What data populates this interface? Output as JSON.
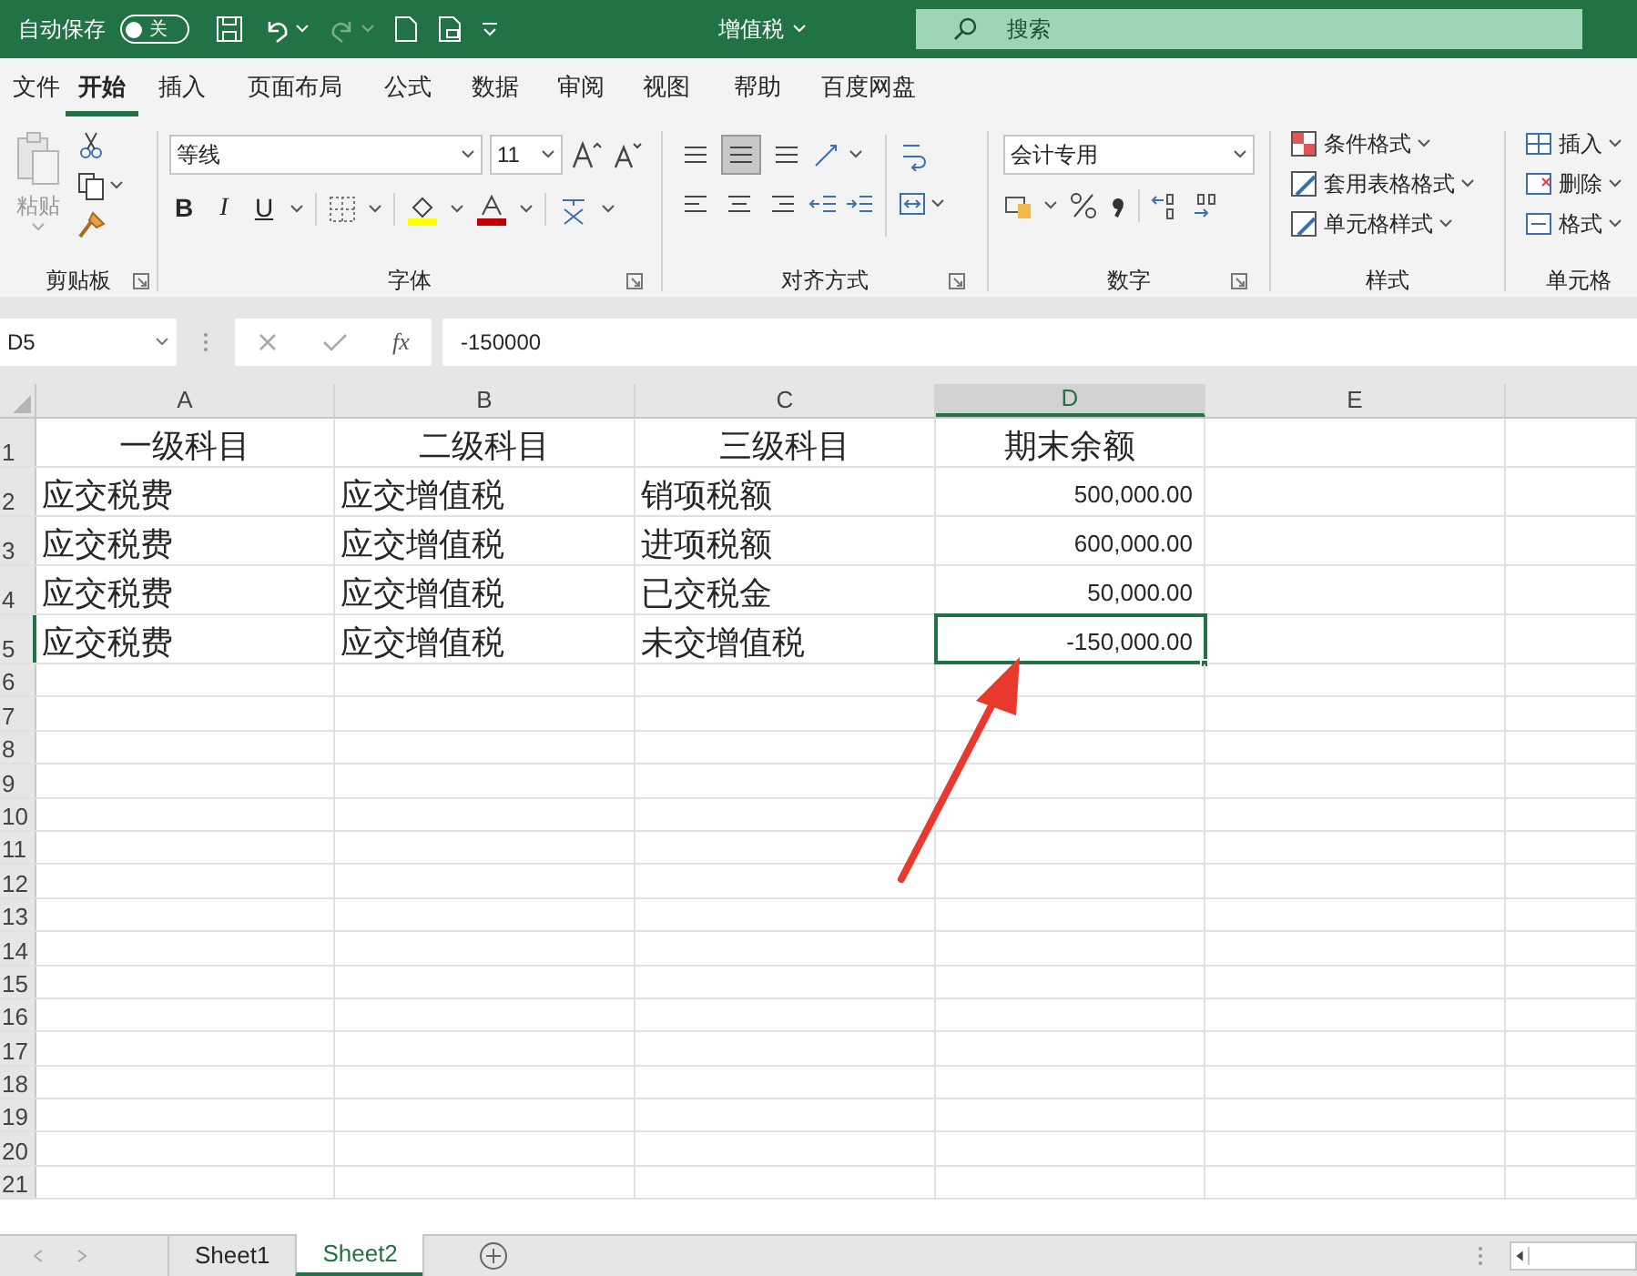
{
  "title_bar": {
    "autosave_label": "自动保存",
    "autosave_toggle": {
      "label": "关",
      "on": false
    },
    "document_title": "增值税",
    "search": {
      "placeholder": "搜索"
    }
  },
  "menu_tabs": [
    {
      "label": "文件",
      "selected": false
    },
    {
      "label": "开始",
      "selected": true
    },
    {
      "label": "插入",
      "selected": false
    },
    {
      "label": "页面布局",
      "selected": false
    },
    {
      "label": "公式",
      "selected": false
    },
    {
      "label": "数据",
      "selected": false
    },
    {
      "label": "审阅",
      "selected": false
    },
    {
      "label": "视图",
      "selected": false
    },
    {
      "label": "帮助",
      "selected": false
    },
    {
      "label": "百度网盘",
      "selected": false
    }
  ],
  "ribbon": {
    "clipboard": {
      "paste_label": "粘贴",
      "group_label": "剪贴板"
    },
    "font": {
      "font_name": "等线",
      "font_size": "11",
      "bold": "B",
      "italic": "I",
      "underline": "U",
      "group_label": "字体"
    },
    "alignment": {
      "group_label": "对齐方式"
    },
    "number": {
      "format": "会计专用",
      "group_label": "数字"
    },
    "styles": {
      "items": [
        "条件格式",
        "套用表格格式",
        "单元格样式"
      ],
      "group_label": "样式"
    },
    "cells": {
      "items": [
        "插入",
        "删除",
        "格式"
      ],
      "group_label": "单元格"
    }
  },
  "formula_bar": {
    "name_box": "D5",
    "function_symbol": "fx",
    "value": "-150000"
  },
  "sheet": {
    "columns": [
      {
        "label": "A",
        "selected": false
      },
      {
        "label": "B",
        "selected": false
      },
      {
        "label": "C",
        "selected": false
      },
      {
        "label": "D",
        "selected": true
      },
      {
        "label": "E",
        "selected": false
      }
    ],
    "rows": [
      {
        "number": "1",
        "selected": false,
        "cells": [
          "一级科目",
          "二级科目",
          "三级科目",
          "期末余额",
          ""
        ]
      },
      {
        "number": "2",
        "selected": false,
        "cells": [
          "应交税费",
          "应交增值税",
          "销项税额",
          "500,000.00",
          ""
        ]
      },
      {
        "number": "3",
        "selected": false,
        "cells": [
          "应交税费",
          "应交增值税",
          "进项税额",
          "600,000.00",
          ""
        ]
      },
      {
        "number": "4",
        "selected": false,
        "cells": [
          "应交税费",
          "应交增值税",
          "已交税金",
          "50,000.00",
          ""
        ]
      },
      {
        "number": "5",
        "selected": true,
        "cells": [
          "应交税费",
          "应交增值税",
          "未交增值税",
          "-150,000.00",
          ""
        ]
      },
      {
        "number": "6",
        "selected": false
      },
      {
        "number": "7",
        "selected": false
      },
      {
        "number": "8",
        "selected": false
      },
      {
        "number": "9",
        "selected": false
      },
      {
        "number": "10",
        "selected": false
      },
      {
        "number": "11",
        "selected": false
      },
      {
        "number": "12",
        "selected": false
      },
      {
        "number": "13",
        "selected": false
      },
      {
        "number": "14",
        "selected": false
      },
      {
        "number": "15",
        "selected": false
      },
      {
        "number": "16",
        "selected": false
      },
      {
        "number": "17",
        "selected": false
      },
      {
        "number": "18",
        "selected": false
      },
      {
        "number": "19",
        "selected": false
      },
      {
        "number": "20",
        "selected": false
      },
      {
        "number": "21",
        "selected": false
      }
    ]
  },
  "sheet_tabs": [
    {
      "label": "Sheet1",
      "selected": false
    },
    {
      "label": "Sheet2",
      "selected": true
    }
  ]
}
